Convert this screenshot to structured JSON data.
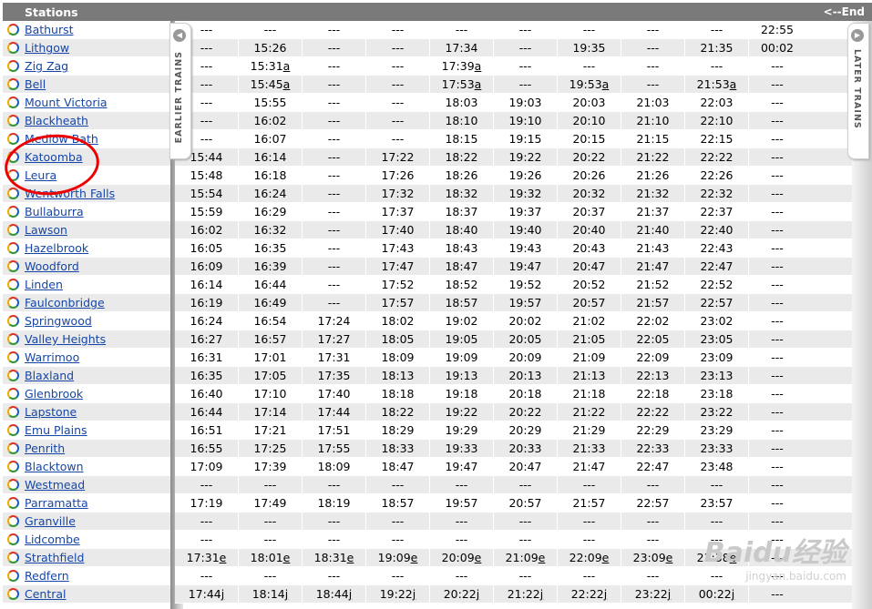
{
  "header": {
    "stations_label": "Stations",
    "end_link": "<--End"
  },
  "tabs": {
    "earlier": "EARLIER TRAINS",
    "later": "LATER TRAINS"
  },
  "watermark": {
    "brand": "Baidu经验",
    "url": "jingyan.baidu.com"
  },
  "rows": [
    {
      "station": "Bathurst",
      "times": [
        "---",
        "---",
        "---",
        "---",
        "---",
        "---",
        "---",
        "---",
        "---",
        "22:55"
      ]
    },
    {
      "station": "Lithgow",
      "times": [
        "---",
        "15:26",
        "---",
        "---",
        "17:34",
        "---",
        "19:35",
        "---",
        "21:35",
        "00:02"
      ]
    },
    {
      "station": "Zig Zag",
      "times": [
        "---",
        "15:31|a",
        "---",
        "---",
        "17:39|a",
        "---",
        "---",
        "---",
        "---",
        "---"
      ]
    },
    {
      "station": "Bell",
      "times": [
        "---",
        "15:45|a",
        "---",
        "---",
        "17:53|a",
        "---",
        "19:53|a",
        "---",
        "21:53|a",
        "---"
      ]
    },
    {
      "station": "Mount Victoria",
      "times": [
        "---",
        "15:55",
        "---",
        "---",
        "18:03",
        "19:03",
        "20:03",
        "21:03",
        "22:03",
        "---"
      ]
    },
    {
      "station": "Blackheath",
      "times": [
        "---",
        "16:02",
        "---",
        "---",
        "18:10",
        "19:10",
        "20:10",
        "21:10",
        "22:10",
        "---"
      ]
    },
    {
      "station": "Medlow Bath",
      "times": [
        "---",
        "16:07",
        "---",
        "---",
        "18:15",
        "19:15",
        "20:15",
        "21:15",
        "22:15",
        "---"
      ]
    },
    {
      "station": "Katoomba",
      "times": [
        "15:44",
        "16:14",
        "---",
        "17:22",
        "18:22",
        "19:22",
        "20:22",
        "21:22",
        "22:22",
        "---"
      ]
    },
    {
      "station": "Leura",
      "times": [
        "15:48",
        "16:18",
        "---",
        "17:26",
        "18:26",
        "19:26",
        "20:26",
        "21:26",
        "22:26",
        "---"
      ]
    },
    {
      "station": "Wentworth Falls",
      "times": [
        "15:54",
        "16:24",
        "---",
        "17:32",
        "18:32",
        "19:32",
        "20:32",
        "21:32",
        "22:32",
        "---"
      ]
    },
    {
      "station": "Bullaburra",
      "times": [
        "15:59",
        "16:29",
        "---",
        "17:37",
        "18:37",
        "19:37",
        "20:37",
        "21:37",
        "22:37",
        "---"
      ]
    },
    {
      "station": "Lawson",
      "times": [
        "16:02",
        "16:32",
        "---",
        "17:40",
        "18:40",
        "19:40",
        "20:40",
        "21:40",
        "22:40",
        "---"
      ]
    },
    {
      "station": "Hazelbrook",
      "times": [
        "16:05",
        "16:35",
        "---",
        "17:43",
        "18:43",
        "19:43",
        "20:43",
        "21:43",
        "22:43",
        "---"
      ]
    },
    {
      "station": "Woodford",
      "times": [
        "16:09",
        "16:39",
        "---",
        "17:47",
        "18:47",
        "19:47",
        "20:47",
        "21:47",
        "22:47",
        "---"
      ]
    },
    {
      "station": "Linden",
      "times": [
        "16:14",
        "16:44",
        "---",
        "17:52",
        "18:52",
        "19:52",
        "20:52",
        "21:52",
        "22:52",
        "---"
      ]
    },
    {
      "station": "Faulconbridge",
      "times": [
        "16:19",
        "16:49",
        "---",
        "17:57",
        "18:57",
        "19:57",
        "20:57",
        "21:57",
        "22:57",
        "---"
      ]
    },
    {
      "station": "Springwood",
      "times": [
        "16:24",
        "16:54",
        "17:24",
        "18:02",
        "19:02",
        "20:02",
        "21:02",
        "22:02",
        "23:02",
        "---"
      ]
    },
    {
      "station": "Valley Heights",
      "times": [
        "16:27",
        "16:57",
        "17:27",
        "18:05",
        "19:05",
        "20:05",
        "21:05",
        "22:05",
        "23:05",
        "---"
      ]
    },
    {
      "station": "Warrimoo",
      "times": [
        "16:31",
        "17:01",
        "17:31",
        "18:09",
        "19:09",
        "20:09",
        "21:09",
        "22:09",
        "23:09",
        "---"
      ]
    },
    {
      "station": "Blaxland",
      "times": [
        "16:35",
        "17:05",
        "17:35",
        "18:13",
        "19:13",
        "20:13",
        "21:13",
        "22:13",
        "23:13",
        "---"
      ]
    },
    {
      "station": "Glenbrook",
      "times": [
        "16:40",
        "17:10",
        "17:40",
        "18:18",
        "19:18",
        "20:18",
        "21:18",
        "22:18",
        "23:18",
        "---"
      ]
    },
    {
      "station": "Lapstone",
      "times": [
        "16:44",
        "17:14",
        "17:44",
        "18:22",
        "19:22",
        "20:22",
        "21:22",
        "22:22",
        "23:22",
        "---"
      ]
    },
    {
      "station": "Emu Plains",
      "times": [
        "16:51",
        "17:21",
        "17:51",
        "18:29",
        "19:29",
        "20:29",
        "21:29",
        "22:29",
        "23:29",
        "---"
      ]
    },
    {
      "station": "Penrith",
      "times": [
        "16:55",
        "17:25",
        "17:55",
        "18:33",
        "19:33",
        "20:33",
        "21:33",
        "22:33",
        "23:33",
        "---"
      ]
    },
    {
      "station": "Blacktown",
      "times": [
        "17:09",
        "17:39",
        "18:09",
        "18:47",
        "19:47",
        "20:47",
        "21:47",
        "22:47",
        "23:48",
        "---"
      ]
    },
    {
      "station": "Westmead",
      "times": [
        "---",
        "---",
        "---",
        "---",
        "---",
        "---",
        "---",
        "---",
        "---",
        "---"
      ]
    },
    {
      "station": "Parramatta",
      "times": [
        "17:19",
        "17:49",
        "18:19",
        "18:57",
        "19:57",
        "20:57",
        "21:57",
        "22:57",
        "23:57",
        "---"
      ]
    },
    {
      "station": "Granville",
      "times": [
        "---",
        "---",
        "---",
        "---",
        "---",
        "---",
        "---",
        "---",
        "---",
        "---"
      ]
    },
    {
      "station": "Lidcombe",
      "times": [
        "---",
        "---",
        "---",
        "---",
        "---",
        "---",
        "---",
        "---",
        "---",
        "---"
      ]
    },
    {
      "station": "Strathfield",
      "times": [
        "17:31|e",
        "18:01|e",
        "18:31|e",
        "19:09|e",
        "20:09|e",
        "21:09|e",
        "22:09|e",
        "23:09|e",
        "23:38|e",
        "---"
      ]
    },
    {
      "station": "Redfern",
      "times": [
        "---",
        "---",
        "---",
        "---",
        "---",
        "---",
        "---",
        "---",
        "---",
        "---"
      ]
    },
    {
      "station": "Central",
      "times": [
        "17:44|j",
        "18:14|j",
        "18:44|j",
        "19:22|j",
        "20:22|j",
        "21:22|j",
        "22:22|j",
        "23:22|j",
        "00:22|j",
        "---"
      ]
    }
  ]
}
